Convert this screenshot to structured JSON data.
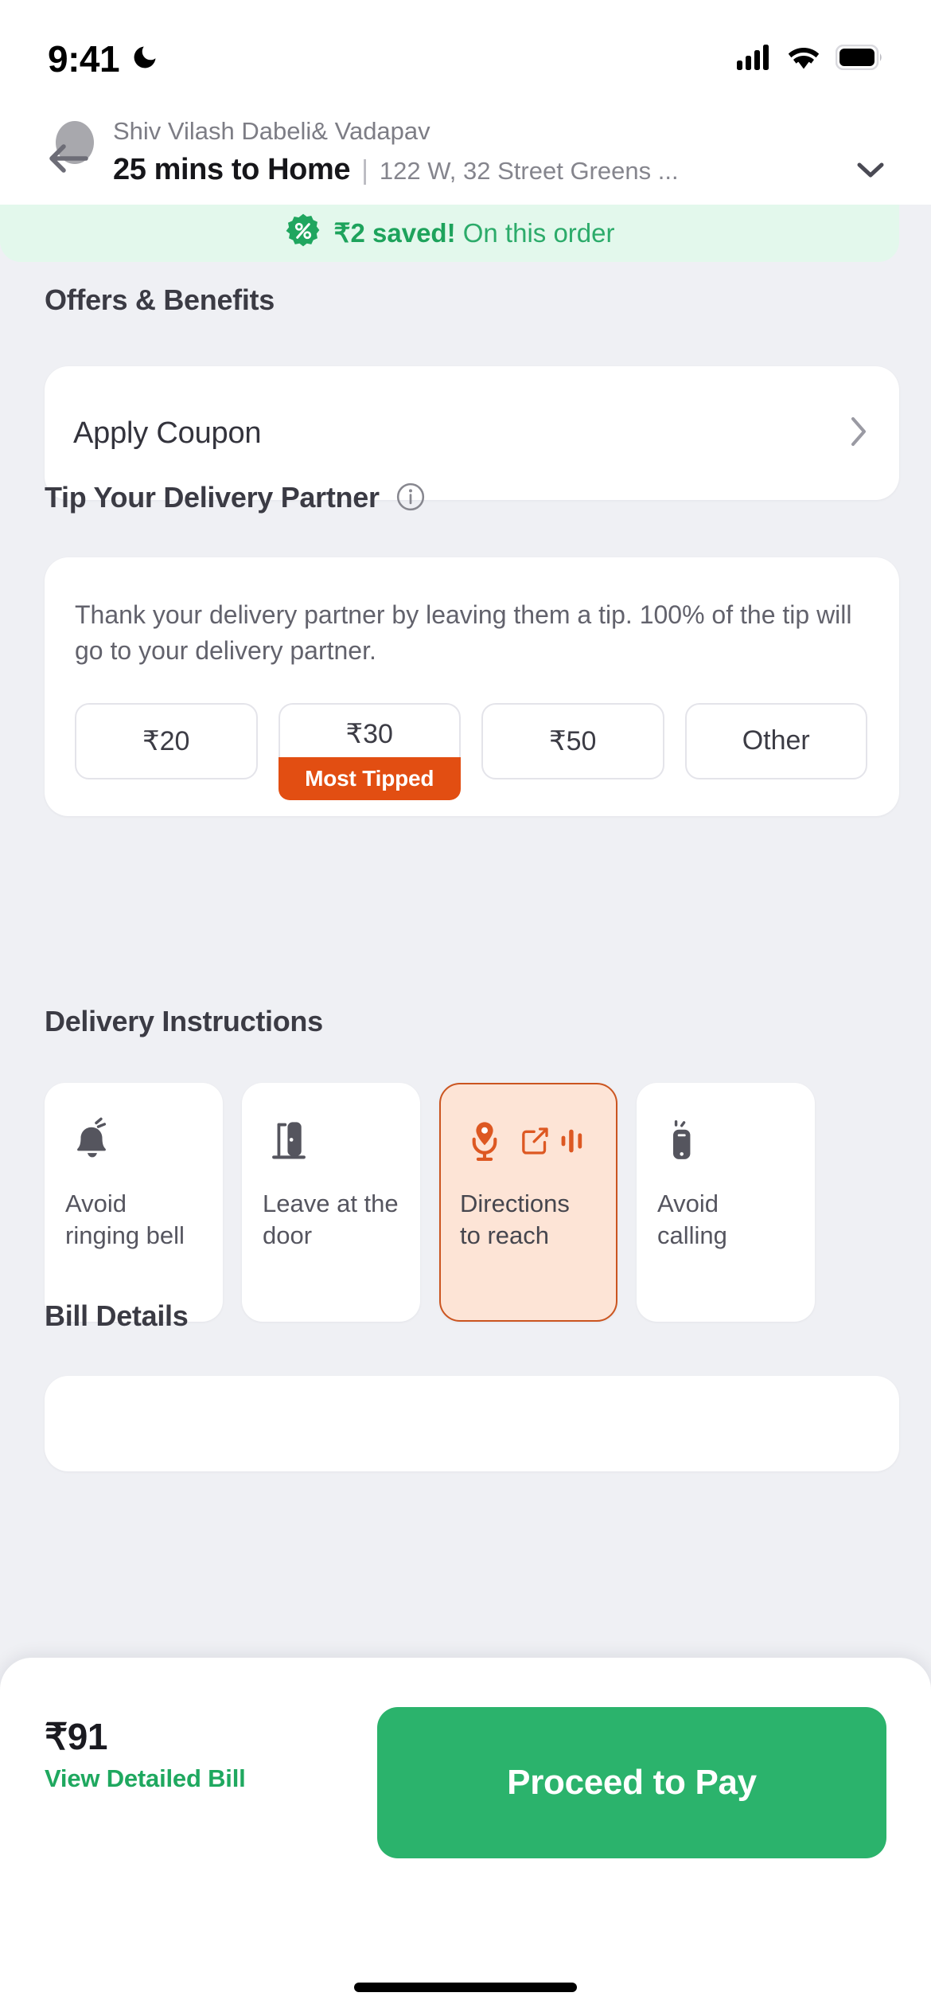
{
  "status_bar": {
    "time": "9:41",
    "moon_icon": "crescent-moon-icon",
    "signal_icon": "cellular-signal-icon",
    "wifi_icon": "wifi-icon",
    "battery_icon": "battery-full-icon"
  },
  "header": {
    "back_icon": "back-arrow-icon",
    "restaurant_name": "Shiv Vilash Dabeli& Vadapav",
    "eta": "25 mins to Home",
    "divider": "|",
    "address": "122 W, 32 Street Greens ...",
    "chevron_icon": "chevron-down-icon"
  },
  "savings_banner": {
    "badge_icon": "percent-badge-icon",
    "amount_label": "₹2 saved!",
    "suffix_label": " On this order"
  },
  "offers": {
    "title": "Offers & Benefits",
    "apply_coupon_label": "Apply Coupon",
    "chevron_icon": "chevron-right-icon"
  },
  "tip": {
    "title": "Tip Your Delivery Partner",
    "info_icon": "info-circle-icon",
    "description": "Thank your delivery partner by leaving them a tip. 100% of the tip will go to your delivery partner.",
    "options": [
      {
        "label": "₹20",
        "badge": ""
      },
      {
        "label": "₹30",
        "badge": "Most Tipped"
      },
      {
        "label": "₹50",
        "badge": ""
      },
      {
        "label": "Other",
        "badge": ""
      }
    ]
  },
  "delivery_instructions": {
    "title": "Delivery Instructions",
    "cards": [
      {
        "label": "Avoid ringing bell",
        "icon": "bell-ringing-icon",
        "selected": false
      },
      {
        "label": "Leave at the door",
        "icon": "door-icon",
        "selected": false
      },
      {
        "label": "Directions to reach",
        "icon": "mic-location-icon",
        "selected": true,
        "extra_icons": [
          "edit-square-icon",
          "audio-waveform-icon"
        ]
      },
      {
        "label": "Avoid calling",
        "icon": "phone-mute-icon",
        "selected": false
      }
    ]
  },
  "bill": {
    "title": "Bill Details"
  },
  "bottom_bar": {
    "total_amount": "₹91",
    "view_bill_label": "View Detailed Bill",
    "pay_button_label": "Proceed to Pay"
  },
  "colors": {
    "brand_green": "#2bb36c",
    "savings_green": "#1ea35c",
    "savings_bg": "#e3f8ec",
    "accent_orange": "#e24e12",
    "selected_bg": "#fde4d6",
    "selected_border": "#cb5520",
    "page_bg": "#eff0f4"
  }
}
